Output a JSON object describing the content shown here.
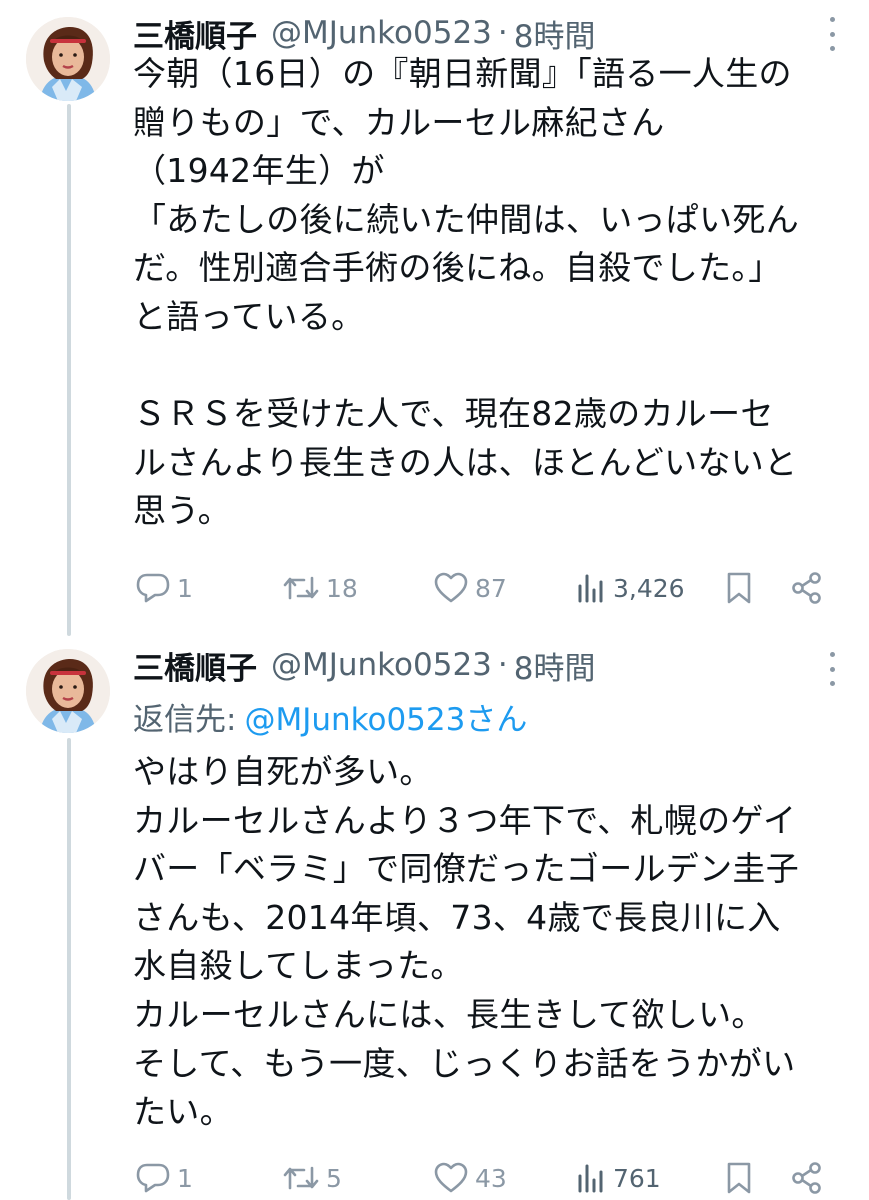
{
  "tweets": [
    {
      "name": "三橋順子",
      "handle": "@MJunko0523",
      "separator": "·",
      "time": "8時間",
      "reply_prefix": "",
      "reply_mention": "",
      "lines": [
        "今朝（16日）の『朝日新聞』「語る一人生の",
        "贈りもの」で、カルーセル麻紀さん",
        "（1942年生）が",
        "「あたしの後に続いた仲間は、いっぱい死ん",
        "だ。性別適合手術の後にね。自殺でした。」",
        "と語っている。",
        "",
        "ＳＲＳを受けた人で、現在82歳のカルーセ",
        "ルさんより長生きの人は、ほとんどいないと",
        "思う。"
      ],
      "replies": "1",
      "retweets": "18",
      "likes": "87",
      "views": "3,426"
    },
    {
      "name": "三橋順子",
      "handle": "@MJunko0523",
      "separator": "·",
      "time": "8時間",
      "reply_prefix": "返信先:",
      "reply_mention": "@MJunko0523さん",
      "lines": [
        "やはり自死が多い。",
        "カルーセルさんより３つ年下で、札幌のゲイ",
        "バー「ベラミ」で同僚だったゴールデン圭子",
        "さんも、2014年頃、73、4歳で長良川に入",
        "水自殺してしまった。",
        "カルーセルさんには、長生きして欲しい。",
        "そして、もう一度、じっくりお話をうかがい",
        "たい。"
      ],
      "replies": "1",
      "retweets": "5",
      "likes": "43",
      "views": "761"
    }
  ],
  "colors": {
    "text": "#0f1419",
    "secondary": "#536471",
    "link": "#1d9bf0",
    "icon": "#8b98a5",
    "thread_line": "#cfd9de"
  },
  "icons": [
    "comment-icon",
    "retweet-icon",
    "like-icon",
    "views-icon",
    "bookmark-icon",
    "share-icon",
    "more-icon"
  ]
}
